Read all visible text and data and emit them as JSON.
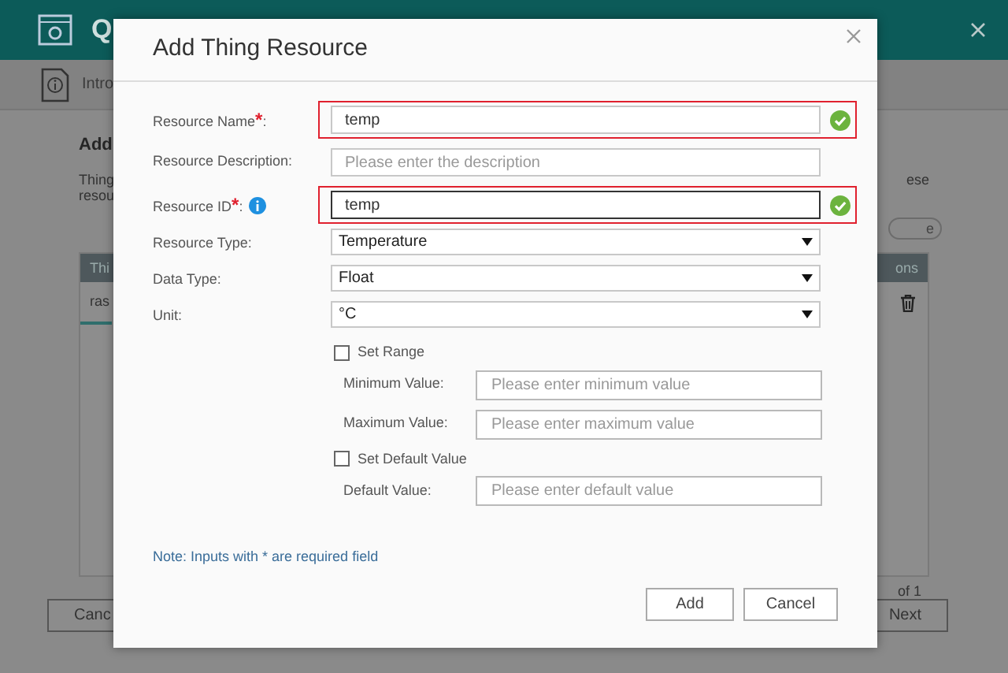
{
  "app": {
    "title": "Q",
    "intro_tab": "Intro",
    "heading": "Add",
    "description_lines": [
      "Thing",
      "resou"
    ],
    "description_right": "ese",
    "pill_button": "e",
    "table": {
      "columns": [
        "Thi",
        "ons"
      ],
      "rows": [
        {
          "cell": "ras"
        }
      ]
    },
    "pagination": "of 1",
    "buttons": [
      "Canc",
      "Next"
    ]
  },
  "dialog": {
    "title": "Add Thing Resource",
    "fields": [
      {
        "kind": "text",
        "label": "Resource Name",
        "required_mark": "*",
        "label_suffix": ":",
        "value": "temp",
        "highlighted": true,
        "valid": true,
        "focused": false
      },
      {
        "kind": "text",
        "label": "Resource Description:",
        "placeholder": "Please enter the description",
        "highlighted": false,
        "valid": false,
        "focused": false
      },
      {
        "kind": "text",
        "label": "Resource ID",
        "required_mark": "*",
        "label_suffix": ":",
        "info": true,
        "value": "temp",
        "highlighted": true,
        "valid": true,
        "focused": true
      },
      {
        "kind": "select",
        "label": "Resource Type:",
        "value": "Temperature"
      },
      {
        "kind": "select",
        "label": "Data Type:",
        "value": "Float"
      },
      {
        "kind": "select",
        "label": "Unit:",
        "value": "°C"
      },
      {
        "kind": "checkbox",
        "label": "Set Range",
        "checked": false
      },
      {
        "kind": "subfield",
        "label": "Minimum Value:",
        "placeholder": "Please enter minimum value"
      },
      {
        "kind": "subfield",
        "label": "Maximum Value:",
        "placeholder": "Please enter maximum value"
      },
      {
        "kind": "checkbox",
        "label": "Set Default Value",
        "checked": false
      },
      {
        "kind": "subfield",
        "label": "Default Value:",
        "placeholder": "Please enter default value"
      }
    ],
    "note": "Note: Inputs with * are required field",
    "buttons": [
      "Add",
      "Cancel"
    ]
  }
}
